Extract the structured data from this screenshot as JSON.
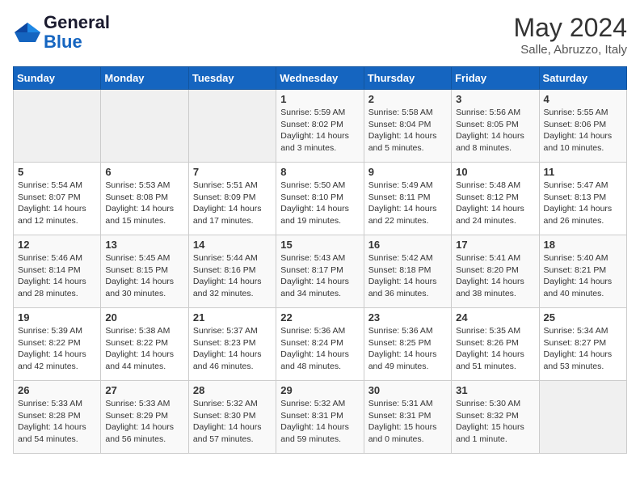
{
  "header": {
    "logo_line1": "General",
    "logo_line2": "Blue",
    "month": "May 2024",
    "location": "Salle, Abruzzo, Italy"
  },
  "weekdays": [
    "Sunday",
    "Monday",
    "Tuesday",
    "Wednesday",
    "Thursday",
    "Friday",
    "Saturday"
  ],
  "weeks": [
    [
      {
        "day": "",
        "sunrise": "",
        "sunset": "",
        "daylight": ""
      },
      {
        "day": "",
        "sunrise": "",
        "sunset": "",
        "daylight": ""
      },
      {
        "day": "",
        "sunrise": "",
        "sunset": "",
        "daylight": ""
      },
      {
        "day": "1",
        "sunrise": "Sunrise: 5:59 AM",
        "sunset": "Sunset: 8:02 PM",
        "daylight": "Daylight: 14 hours and 3 minutes."
      },
      {
        "day": "2",
        "sunrise": "Sunrise: 5:58 AM",
        "sunset": "Sunset: 8:04 PM",
        "daylight": "Daylight: 14 hours and 5 minutes."
      },
      {
        "day": "3",
        "sunrise": "Sunrise: 5:56 AM",
        "sunset": "Sunset: 8:05 PM",
        "daylight": "Daylight: 14 hours and 8 minutes."
      },
      {
        "day": "4",
        "sunrise": "Sunrise: 5:55 AM",
        "sunset": "Sunset: 8:06 PM",
        "daylight": "Daylight: 14 hours and 10 minutes."
      }
    ],
    [
      {
        "day": "5",
        "sunrise": "Sunrise: 5:54 AM",
        "sunset": "Sunset: 8:07 PM",
        "daylight": "Daylight: 14 hours and 12 minutes."
      },
      {
        "day": "6",
        "sunrise": "Sunrise: 5:53 AM",
        "sunset": "Sunset: 8:08 PM",
        "daylight": "Daylight: 14 hours and 15 minutes."
      },
      {
        "day": "7",
        "sunrise": "Sunrise: 5:51 AM",
        "sunset": "Sunset: 8:09 PM",
        "daylight": "Daylight: 14 hours and 17 minutes."
      },
      {
        "day": "8",
        "sunrise": "Sunrise: 5:50 AM",
        "sunset": "Sunset: 8:10 PM",
        "daylight": "Daylight: 14 hours and 19 minutes."
      },
      {
        "day": "9",
        "sunrise": "Sunrise: 5:49 AM",
        "sunset": "Sunset: 8:11 PM",
        "daylight": "Daylight: 14 hours and 22 minutes."
      },
      {
        "day": "10",
        "sunrise": "Sunrise: 5:48 AM",
        "sunset": "Sunset: 8:12 PM",
        "daylight": "Daylight: 14 hours and 24 minutes."
      },
      {
        "day": "11",
        "sunrise": "Sunrise: 5:47 AM",
        "sunset": "Sunset: 8:13 PM",
        "daylight": "Daylight: 14 hours and 26 minutes."
      }
    ],
    [
      {
        "day": "12",
        "sunrise": "Sunrise: 5:46 AM",
        "sunset": "Sunset: 8:14 PM",
        "daylight": "Daylight: 14 hours and 28 minutes."
      },
      {
        "day": "13",
        "sunrise": "Sunrise: 5:45 AM",
        "sunset": "Sunset: 8:15 PM",
        "daylight": "Daylight: 14 hours and 30 minutes."
      },
      {
        "day": "14",
        "sunrise": "Sunrise: 5:44 AM",
        "sunset": "Sunset: 8:16 PM",
        "daylight": "Daylight: 14 hours and 32 minutes."
      },
      {
        "day": "15",
        "sunrise": "Sunrise: 5:43 AM",
        "sunset": "Sunset: 8:17 PM",
        "daylight": "Daylight: 14 hours and 34 minutes."
      },
      {
        "day": "16",
        "sunrise": "Sunrise: 5:42 AM",
        "sunset": "Sunset: 8:18 PM",
        "daylight": "Daylight: 14 hours and 36 minutes."
      },
      {
        "day": "17",
        "sunrise": "Sunrise: 5:41 AM",
        "sunset": "Sunset: 8:20 PM",
        "daylight": "Daylight: 14 hours and 38 minutes."
      },
      {
        "day": "18",
        "sunrise": "Sunrise: 5:40 AM",
        "sunset": "Sunset: 8:21 PM",
        "daylight": "Daylight: 14 hours and 40 minutes."
      }
    ],
    [
      {
        "day": "19",
        "sunrise": "Sunrise: 5:39 AM",
        "sunset": "Sunset: 8:22 PM",
        "daylight": "Daylight: 14 hours and 42 minutes."
      },
      {
        "day": "20",
        "sunrise": "Sunrise: 5:38 AM",
        "sunset": "Sunset: 8:22 PM",
        "daylight": "Daylight: 14 hours and 44 minutes."
      },
      {
        "day": "21",
        "sunrise": "Sunrise: 5:37 AM",
        "sunset": "Sunset: 8:23 PM",
        "daylight": "Daylight: 14 hours and 46 minutes."
      },
      {
        "day": "22",
        "sunrise": "Sunrise: 5:36 AM",
        "sunset": "Sunset: 8:24 PM",
        "daylight": "Daylight: 14 hours and 48 minutes."
      },
      {
        "day": "23",
        "sunrise": "Sunrise: 5:36 AM",
        "sunset": "Sunset: 8:25 PM",
        "daylight": "Daylight: 14 hours and 49 minutes."
      },
      {
        "day": "24",
        "sunrise": "Sunrise: 5:35 AM",
        "sunset": "Sunset: 8:26 PM",
        "daylight": "Daylight: 14 hours and 51 minutes."
      },
      {
        "day": "25",
        "sunrise": "Sunrise: 5:34 AM",
        "sunset": "Sunset: 8:27 PM",
        "daylight": "Daylight: 14 hours and 53 minutes."
      }
    ],
    [
      {
        "day": "26",
        "sunrise": "Sunrise: 5:33 AM",
        "sunset": "Sunset: 8:28 PM",
        "daylight": "Daylight: 14 hours and 54 minutes."
      },
      {
        "day": "27",
        "sunrise": "Sunrise: 5:33 AM",
        "sunset": "Sunset: 8:29 PM",
        "daylight": "Daylight: 14 hours and 56 minutes."
      },
      {
        "day": "28",
        "sunrise": "Sunrise: 5:32 AM",
        "sunset": "Sunset: 8:30 PM",
        "daylight": "Daylight: 14 hours and 57 minutes."
      },
      {
        "day": "29",
        "sunrise": "Sunrise: 5:32 AM",
        "sunset": "Sunset: 8:31 PM",
        "daylight": "Daylight: 14 hours and 59 minutes."
      },
      {
        "day": "30",
        "sunrise": "Sunrise: 5:31 AM",
        "sunset": "Sunset: 8:31 PM",
        "daylight": "Daylight: 15 hours and 0 minutes."
      },
      {
        "day": "31",
        "sunrise": "Sunrise: 5:30 AM",
        "sunset": "Sunset: 8:32 PM",
        "daylight": "Daylight: 15 hours and 1 minute."
      },
      {
        "day": "",
        "sunrise": "",
        "sunset": "",
        "daylight": ""
      }
    ]
  ]
}
